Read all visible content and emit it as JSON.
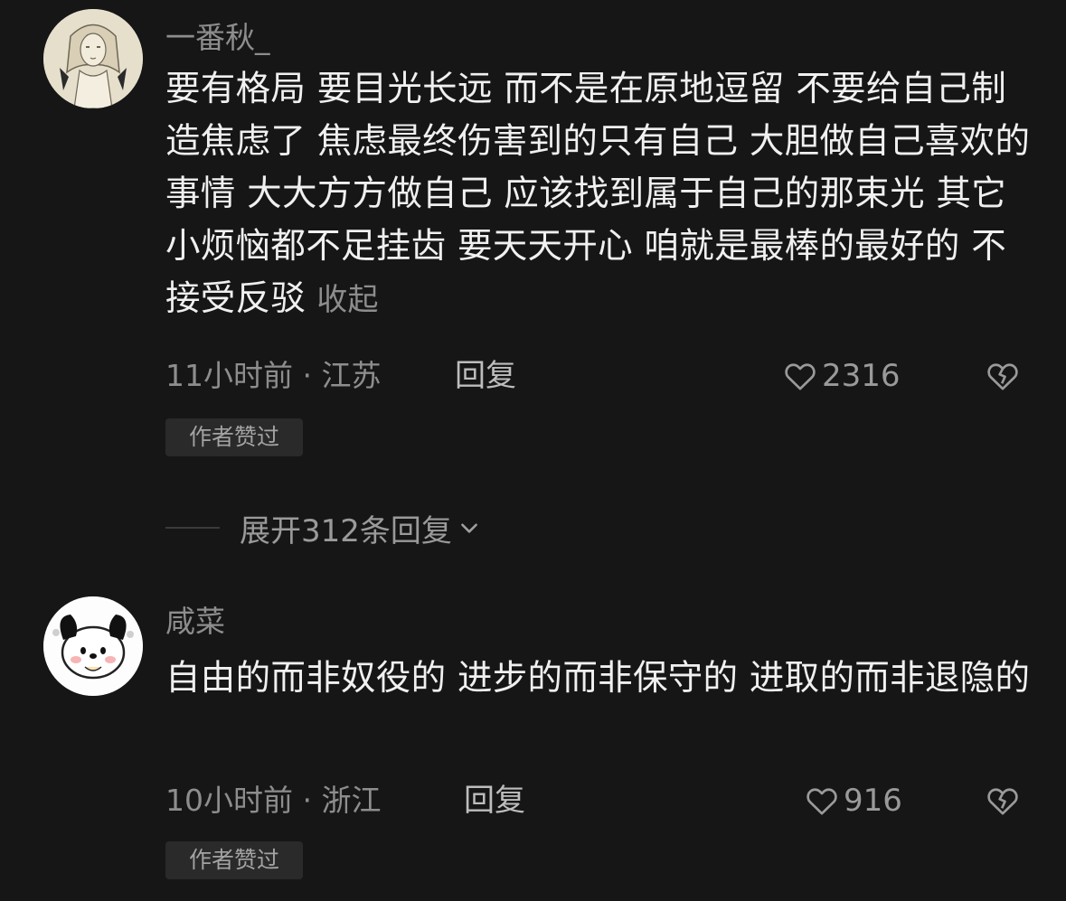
{
  "comments": [
    {
      "username": "一番秋_",
      "avatar": "illustrated-woman-avatar",
      "text": "要有格局 要目光长远 而不是在原地逗留 不要给自己制造焦虑了 焦虑最终伤害到的只有自己 大胆做自己喜欢的事情 大大方方做自己 应该找到属于自己的那束光 其它小烦恼都不足挂齿 要天天开心 咱就是最棒的最好的 不接受反驳",
      "collapse_label": "收起",
      "time_location": "11小时前 · 江苏",
      "reply_label": "回复",
      "likes": "2316",
      "badge": "作者赞过"
    },
    {
      "username": "咸菜",
      "avatar": "pochacco-cartoon-avatar",
      "text": "自由的而非奴役的 进步的而非保守的 进取的而非退隐的",
      "time_location": "10小时前 · 浙江",
      "reply_label": "回复",
      "likes": "916",
      "badge": "作者赞过"
    }
  ],
  "expand_replies": {
    "label": "展开312条回复"
  },
  "icons": {
    "like": "heart-outline-icon",
    "dislike": "broken-heart-icon",
    "expand": "chevron-down-icon"
  },
  "colors": {
    "background": "#161616",
    "primary_text": "#f0f0f0",
    "secondary_text": "#8d8d8d",
    "badge_background": "#2a2a2a"
  }
}
